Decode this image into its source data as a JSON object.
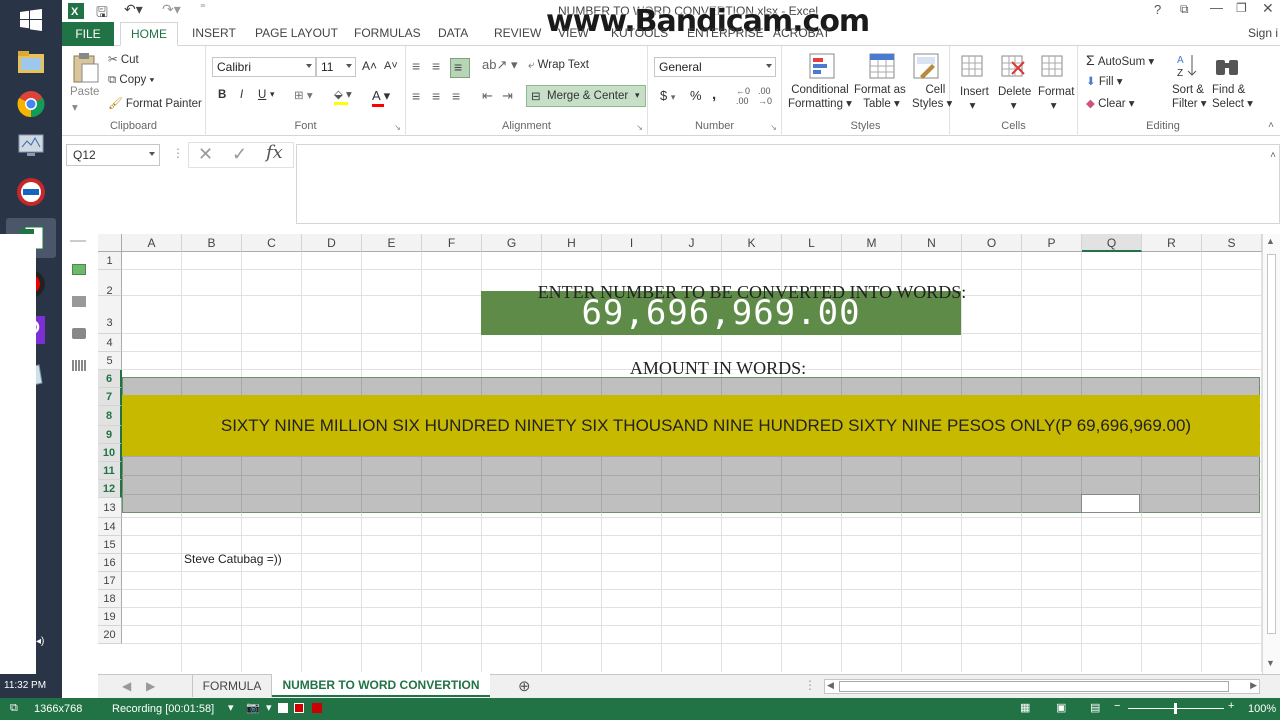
{
  "window": {
    "title": "NUMBER TO WORD CONVERTION.xlsx - Excel",
    "watermark": "www.Bandicam.com",
    "sign_in": "Sign i"
  },
  "ribbon_tabs": [
    "INSERT",
    "PAGE LAYOUT",
    "FORMULAS",
    "DATA",
    "REVIEW",
    "VIEW",
    "KUTOOLS",
    "ENTERPRISE",
    "ACROBAT"
  ],
  "file_tab": "FILE",
  "home_tab": "HOME",
  "clipboard": {
    "paste": "Paste",
    "cut": "Cut",
    "copy": "Copy",
    "format_painter": "Format Painter",
    "label": "Clipboard"
  },
  "font": {
    "name": "Calibri",
    "size": "11",
    "bold": "B",
    "italic": "I",
    "underline": "U",
    "label": "Font"
  },
  "alignment": {
    "wrap": "Wrap Text",
    "merge": "Merge & Center",
    "label": "Alignment"
  },
  "number": {
    "format": "General",
    "currency": "$",
    "percent": "%",
    "comma": ",",
    "label": "Number"
  },
  "styles": {
    "conditional": "Conditional",
    "conditional2": "Formatting",
    "format_table": "Format as",
    "format_table2": "Table",
    "cell_styles": "Cell",
    "cell_styles2": "Styles",
    "label": "Styles"
  },
  "cells": {
    "insert": "Insert",
    "delete": "Delete",
    "format": "Format",
    "label": "Cells"
  },
  "editing": {
    "autosum": "AutoSum",
    "fill": "Fill",
    "clear": "Clear",
    "sort": "Sort &",
    "sort2": "Filter",
    "find": "Find &",
    "find2": "Select",
    "label": "Editing"
  },
  "formula_bar": {
    "name_box": "Q12",
    "fx": "fx",
    "value": ""
  },
  "columns": [
    "A",
    "B",
    "C",
    "D",
    "E",
    "F",
    "G",
    "H",
    "I",
    "J",
    "K",
    "L",
    "M",
    "N",
    "O",
    "P",
    "Q",
    "R",
    "S"
  ],
  "rows": [
    "1",
    "2",
    "3",
    "4",
    "5",
    "6",
    "7",
    "8",
    "9",
    "10",
    "11",
    "12",
    "13",
    "14",
    "15",
    "16",
    "17",
    "18",
    "19",
    "20"
  ],
  "cells_content": {
    "prompt": "ENTER NUMBER TO BE CONVERTED  INTO WORDS:",
    "input_value": "69,696,969.00",
    "words_label": "AMOUNT IN WORDS:",
    "words": "SIXTY NINE  MILLION SIX   HUNDRED  NINETY SIX  THOUSAND NINE  HUNDRED SIXTY NINE  PESOS  ONLY(P 69,696,969.00)",
    "author": "Steve Catubag =))"
  },
  "sheet_tabs": [
    "FORMULA",
    "NUMBER TO WORD CONVERTION"
  ],
  "active_sheet": "NUMBER TO WORD CONVERTION",
  "status_bar": {
    "resolution": "1366x768",
    "recording": "Recording [00:01:58]",
    "zoom": "100%"
  },
  "clock": "11:32 PM",
  "colors": {
    "excel_green": "#217346",
    "input_fill": "#5e8c48",
    "words_fill": "#c7b800",
    "gray_fill": "#bfbfbf",
    "taskbar": "#2a3447"
  }
}
